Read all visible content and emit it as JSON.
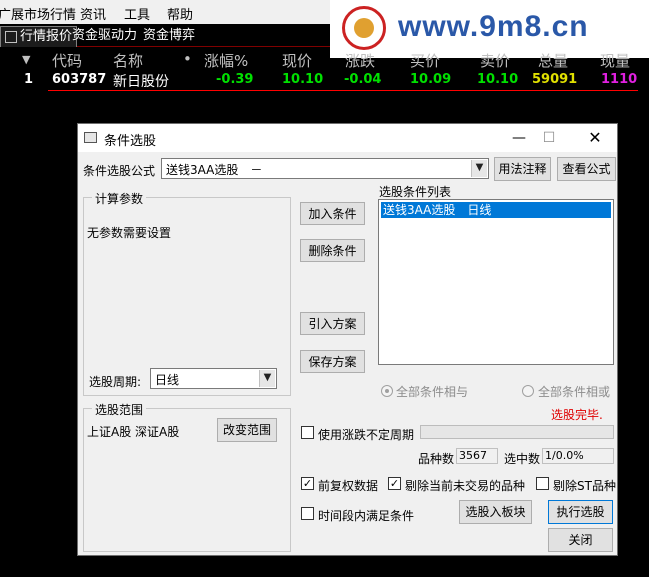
{
  "menu": {
    "items": [
      "广展市场行情",
      "资讯",
      "工具",
      "帮助"
    ]
  },
  "watermark": {
    "text": "www.9m8.cn"
  },
  "tabs": [
    {
      "label": "行情报价",
      "active": true
    },
    {
      "label": "资金驱动力",
      "active": false
    },
    {
      "label": "资金博弈",
      "active": false
    }
  ],
  "quote": {
    "headers": [
      "代码",
      "名称",
      "•",
      "涨幅%",
      "现价",
      "涨跌",
      "买价",
      "卖价",
      "总量",
      "现量"
    ],
    "row": {
      "index": "1",
      "code": "603787",
      "name": "新日股份",
      "change_pct": "-0.39",
      "price": "10.10",
      "change": "-0.04",
      "bid": "10.09",
      "ask": "10.10",
      "volume": "59091",
      "last_vol": "1110"
    },
    "colors": {
      "down": "#00e000",
      "price": "#00e000",
      "vol": "#e0e000",
      "last_vol": "#e020e0",
      "code": "#ffffff"
    }
  },
  "dialog": {
    "title": "条件选股",
    "formula_label": "条件选股公式",
    "formula_value": "送钱3AA选股　－",
    "btn_usage": "用法注释",
    "btn_view_formula": "查看公式",
    "params_group": "计算参数",
    "params_text": "无参数需要设置",
    "period_label": "选股周期:",
    "period_value": "日线",
    "btn_add": "加入条件",
    "btn_delete": "删除条件",
    "btn_import": "引入方案",
    "btn_save": "保存方案",
    "list_label": "选股条件列表",
    "list_items": [
      "送钱3AA选股　日线"
    ],
    "radio_and": "全部条件相与",
    "radio_or": "全部条件相或",
    "status": "选股完毕.",
    "scope_group": "选股范围",
    "scope_text": "上证A股 深证A股",
    "btn_change_scope": "改变范围",
    "chk_uncertain_period": "使用涨跌不定周期",
    "count_label": "品种数",
    "count_value": "3567",
    "selected_label": "选中数",
    "selected_value": "1/0.0%",
    "chk_prerights": "前复权数据",
    "chk_exclude_untraded": "剔除当前未交易的品种",
    "chk_exclude_st": "剔除ST品种",
    "chk_time_period": "时间段内满足条件",
    "btn_to_block": "选股入板块",
    "btn_execute": "执行选股",
    "btn_close": "关闭"
  }
}
